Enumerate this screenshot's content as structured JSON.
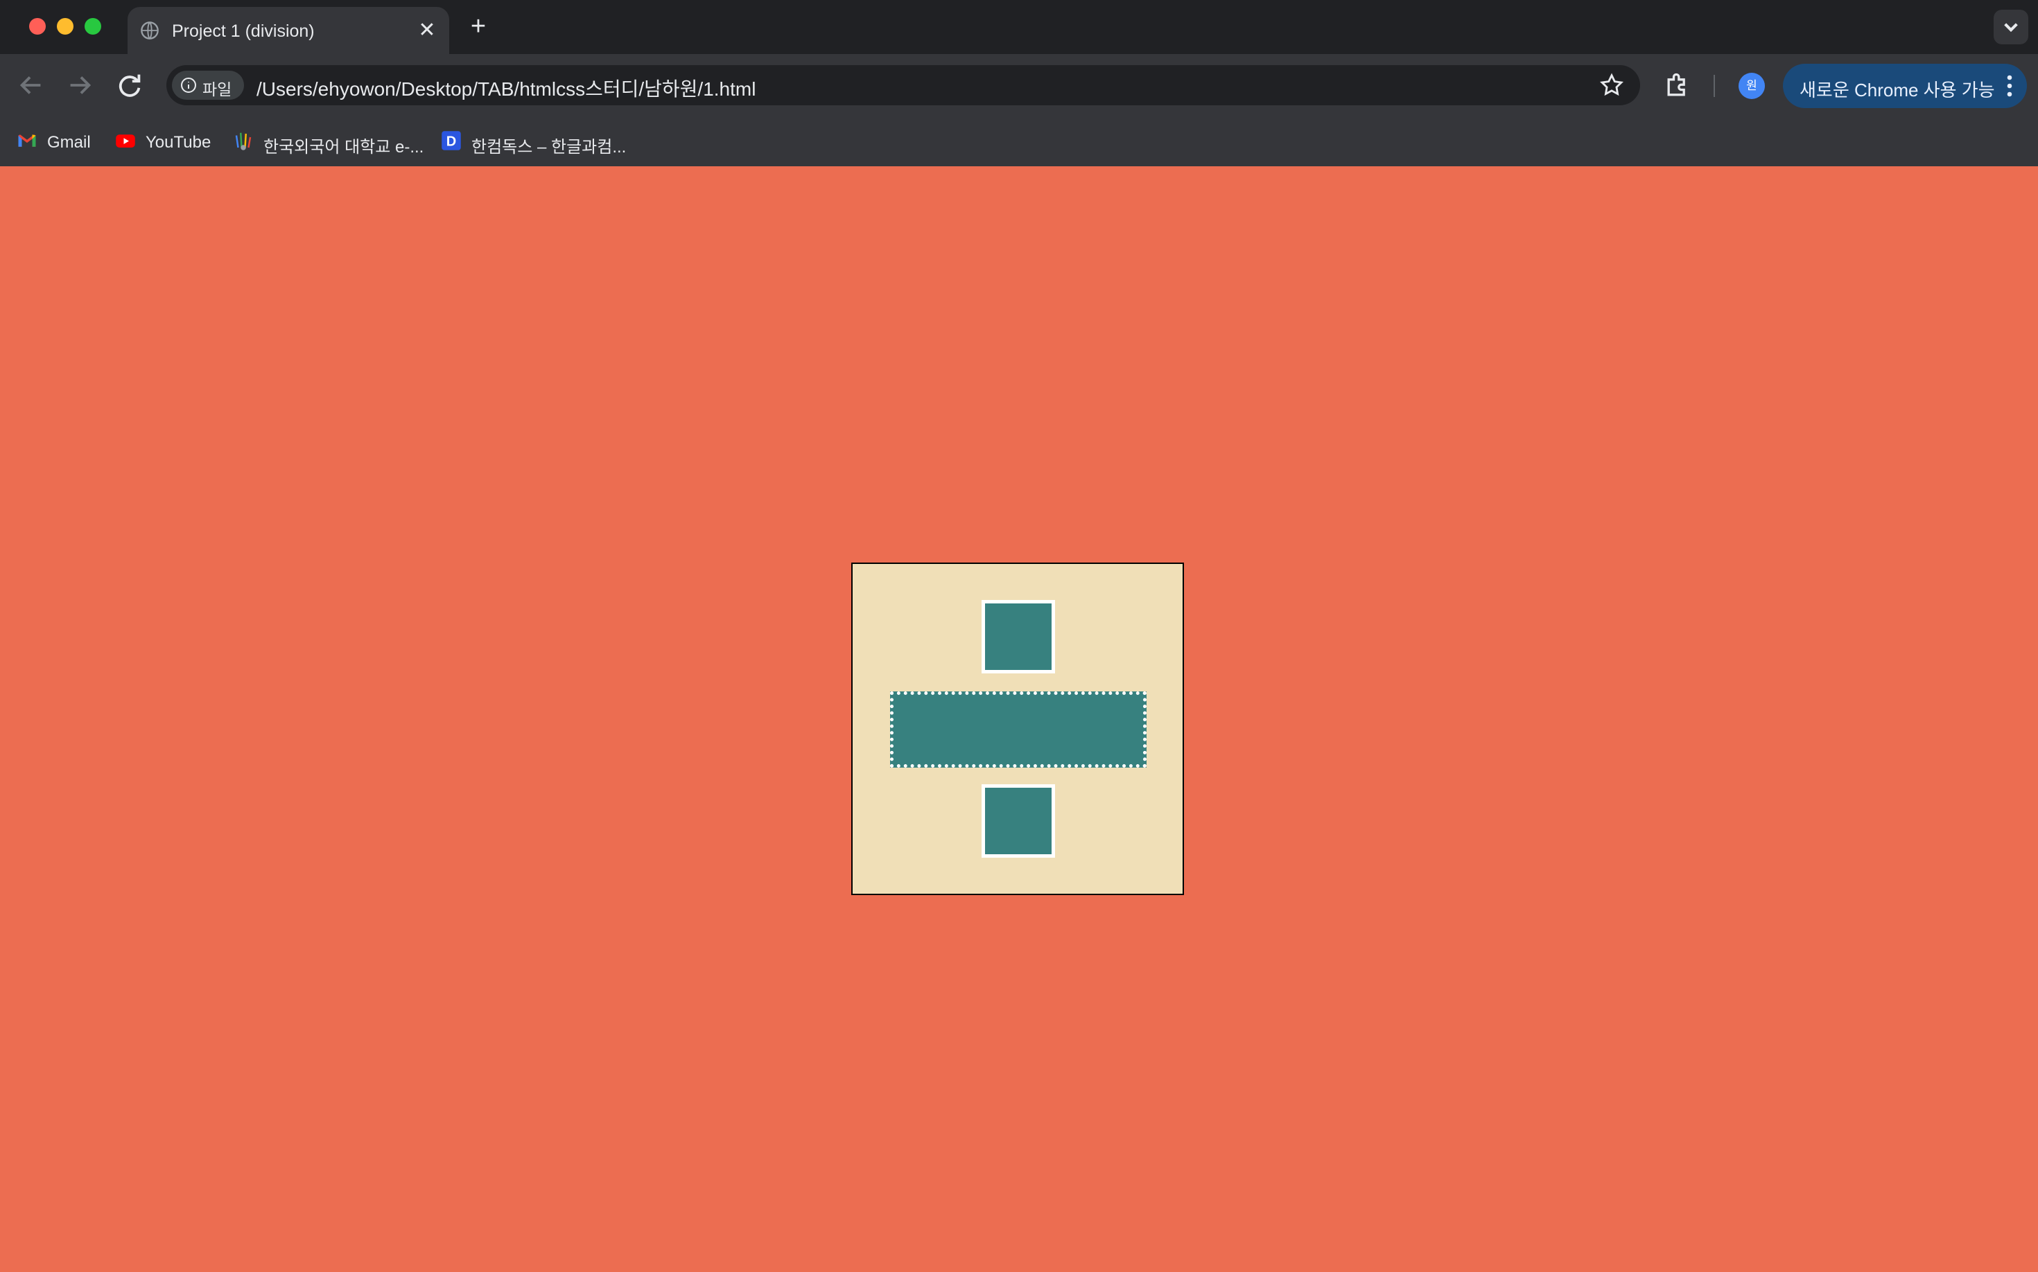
{
  "window": {
    "tab_title": "Project 1 (division)",
    "tab_close": "✕",
    "new_tab": "+"
  },
  "toolbar": {
    "site_chip_label": "파일",
    "url": "/Users/ehyowon/Desktop/TAB/htmlcss스터디/남하원/1.html",
    "profile_initial": "원",
    "update_button_label": "새로운 Chrome 사용 가능"
  },
  "bookmarks": [
    {
      "label": "Gmail",
      "icon": "gmail-icon"
    },
    {
      "label": "YouTube",
      "icon": "youtube-icon"
    },
    {
      "label": "한국외국어 대학교 e-...",
      "icon": "hufs-icon"
    },
    {
      "label": "한컴독스 – 한글과컴...",
      "icon": "hancom-docs-icon"
    }
  ],
  "page": {
    "background_color": "#ec6d51",
    "box_color": "#f0dfb7",
    "shape_color": "#37817f"
  }
}
